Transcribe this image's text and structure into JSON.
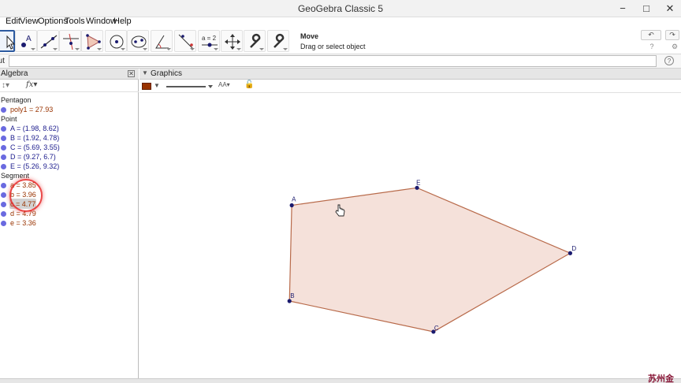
{
  "window": {
    "title": "GeoGebra Classic 5",
    "min": "−",
    "max": "□",
    "close": "✕"
  },
  "menu": [
    "Edit",
    "View",
    "Options",
    "Tools",
    "Window",
    "Help"
  ],
  "toolbar": {
    "tools": [
      "move",
      "point",
      "line",
      "perpendicular",
      "polygon",
      "circle",
      "conic",
      "angle",
      "reflect",
      "slider",
      "move-graphics-view",
      "wrench",
      "wrench"
    ],
    "slider_label": "a = 2",
    "active_tool_name": "Move",
    "active_tool_description": "Drag or select object",
    "undo_label": "↶",
    "redo_label": "↷",
    "help_icon": "?",
    "settings_icon": "⚙"
  },
  "input_bar": {
    "label": "out",
    "value": "",
    "help": "?"
  },
  "algebra": {
    "title": "Algebra",
    "groups": [
      {
        "name": "Pentagon",
        "items": [
          {
            "text": "poly1 = 27.93",
            "color": "#993300"
          }
        ]
      },
      {
        "name": "Point",
        "items": [
          {
            "text": "A = (1.98, 8.62)",
            "color": "#1a1a8c"
          },
          {
            "text": "B = (1.92, 4.78)",
            "color": "#1a1a8c"
          },
          {
            "text": "C = (5.69, 3.55)",
            "color": "#1a1a8c"
          },
          {
            "text": "D = (9.27, 6.7)",
            "color": "#1a1a8c"
          },
          {
            "text": "E = (5.26, 9.32)",
            "color": "#1a1a8c"
          }
        ]
      },
      {
        "name": "Segment",
        "items": [
          {
            "text": "a = 3.85",
            "color": "#993300"
          },
          {
            "text": "b = 3.96",
            "color": "#993300"
          },
          {
            "text": "c = 4.77",
            "color": "#993300"
          },
          {
            "text": "d = 4.79",
            "color": "#993300"
          },
          {
            "text": "e = 3.36",
            "color": "#993300"
          }
        ]
      }
    ]
  },
  "graphics": {
    "title": "Graphics",
    "label_style": "AA",
    "points": [
      {
        "label": "A",
        "x": 1.98,
        "y": 8.62
      },
      {
        "label": "B",
        "x": 1.92,
        "y": 4.78
      },
      {
        "label": "C",
        "x": 5.69,
        "y": 3.55
      },
      {
        "label": "D",
        "x": 9.27,
        "y": 6.7
      },
      {
        "label": "E",
        "x": 5.26,
        "y": 9.32
      }
    ],
    "polygon_fill": "#f5e1da",
    "polygon_stroke": "#b86a4a",
    "point_color": "#1a1a6e"
  },
  "colors": {
    "dot": "#6a6ae0",
    "accent": "#2c5aa0"
  },
  "watermark": "苏州金晓"
}
